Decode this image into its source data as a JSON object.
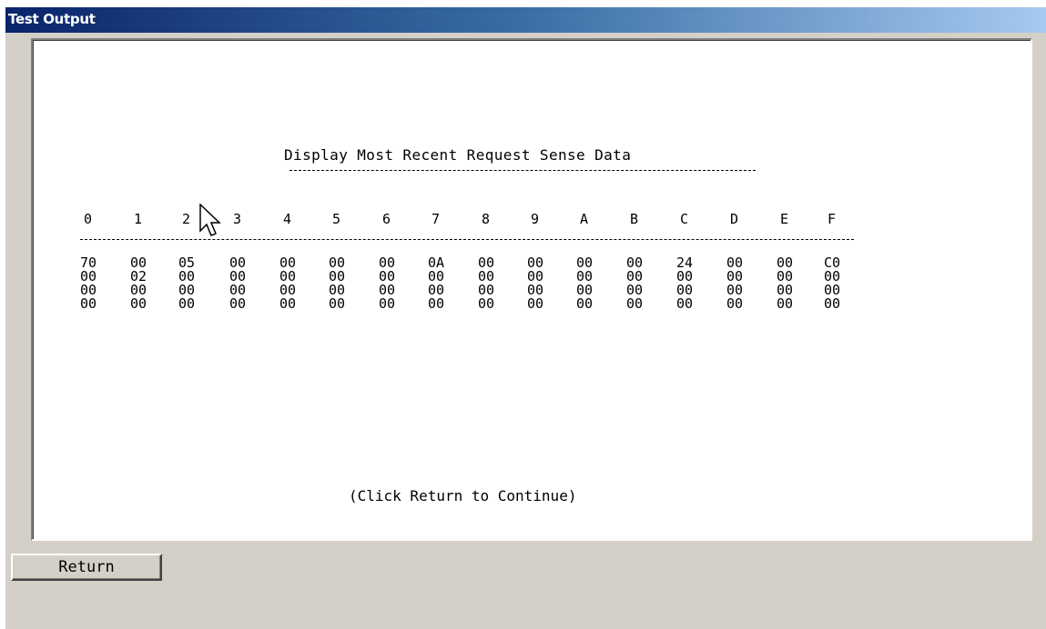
{
  "window": {
    "title": "Test Output"
  },
  "panel": {
    "heading": "Display Most Recent Request Sense Data",
    "column_headers": [
      "0",
      "1",
      "2",
      "3",
      "4",
      "5",
      "6",
      "7",
      "8",
      "9",
      "A",
      "B",
      "C",
      "D",
      "E",
      "F"
    ],
    "rows": [
      [
        "70",
        "00",
        "05",
        "00",
        "00",
        "00",
        "00",
        "0A",
        "00",
        "00",
        "00",
        "00",
        "24",
        "00",
        "00",
        "C0"
      ],
      [
        "00",
        "02",
        "00",
        "00",
        "00",
        "00",
        "00",
        "00",
        "00",
        "00",
        "00",
        "00",
        "00",
        "00",
        "00",
        "00"
      ],
      [
        "00",
        "00",
        "00",
        "00",
        "00",
        "00",
        "00",
        "00",
        "00",
        "00",
        "00",
        "00",
        "00",
        "00",
        "00",
        "00"
      ],
      [
        "00",
        "00",
        "00",
        "00",
        "00",
        "00",
        "00",
        "00",
        "00",
        "00",
        "00",
        "00",
        "00",
        "00",
        "00",
        "00"
      ]
    ],
    "footer": "(Click Return to Continue)"
  },
  "buttons": {
    "return_label": "Return"
  },
  "icons": {
    "cursor": "mouse-pointer-icon"
  }
}
